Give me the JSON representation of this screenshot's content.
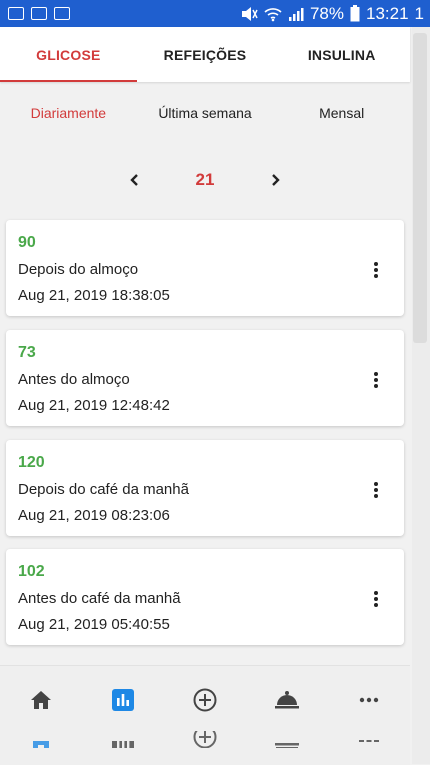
{
  "status_bar": {
    "battery": "78%",
    "time": "13:21",
    "edge_char": "1"
  },
  "tabs": [
    {
      "label": "GLICOSE",
      "active": true
    },
    {
      "label": "REFEIÇÕES",
      "active": false
    },
    {
      "label": "INSULINA",
      "active": false
    }
  ],
  "period": [
    {
      "label": "Diariamente",
      "active": true
    },
    {
      "label": "Última semana",
      "active": false
    },
    {
      "label": "Mensal",
      "active": false
    }
  ],
  "day_nav": {
    "day": "21",
    "prev_icon": "chevron-left-icon",
    "next_icon": "chevron-right-icon"
  },
  "readings": [
    {
      "value": "90",
      "meal": "Depois do almoço",
      "time": "Aug 21, 2019 18:38:05"
    },
    {
      "value": "73",
      "meal": "Antes do almoço",
      "time": "Aug 21, 2019 12:48:42"
    },
    {
      "value": "120",
      "meal": "Depois do café da manhã",
      "time": "Aug 21, 2019 08:23:06"
    },
    {
      "value": "102",
      "meal": "Antes do café da manhã",
      "time": "Aug 21, 2019 05:40:55"
    }
  ],
  "bottom_nav": [
    {
      "icon": "home-icon"
    },
    {
      "icon": "bar-chart-icon",
      "active": true
    },
    {
      "icon": "add-circle-icon"
    },
    {
      "icon": "food-cloche-icon"
    },
    {
      "icon": "more-horizontal-icon"
    }
  ],
  "colors": {
    "accent": "#d23b3b",
    "reading_value": "#4aa84a",
    "status_bar": "#1f5fcf",
    "active_nav": "#1e88e5"
  }
}
